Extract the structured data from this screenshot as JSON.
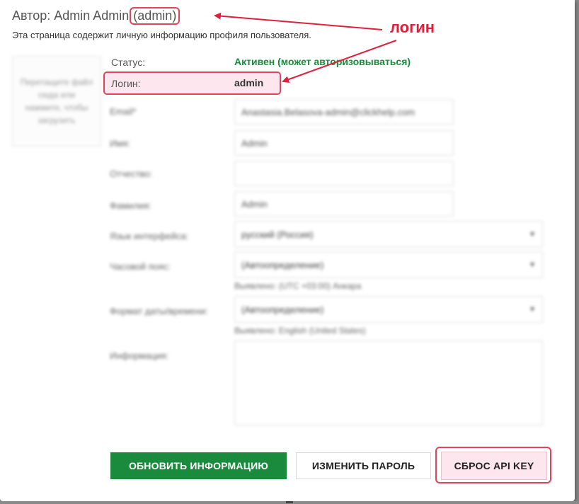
{
  "header": {
    "title_prefix": "Автор: Admin Admin",
    "title_login": "(admin)",
    "subtitle": "Эта страница содержит личную информацию профиля пользователя."
  },
  "annotation": {
    "label": "логин",
    "color": "#e0203a"
  },
  "avatar": {
    "dropzone_text": "Перетащите файл сюда или нажмите, чтобы загрузить"
  },
  "profile": {
    "status_label": "Статус:",
    "status_value": "Активен (может авторизовываться)",
    "login_label": "Логин:",
    "login_value": "admin",
    "fields": {
      "email_label": "Email*",
      "email_value": "Anastasia.Belasova-admin@clickhelp.com",
      "name_label": "Имя:",
      "name_value": "Admin",
      "patronymic_label": "Отчество:",
      "patronymic_value": "",
      "surname_label": "Фамилия:",
      "surname_value": "Admin",
      "language_label": "Язык интерфейса:",
      "language_value": "русский (Россия)",
      "timezone_label": "Часовой пояс:",
      "timezone_value": "(Автоопределение)",
      "timezone_hint": "Выявлено: (UTC +03:00) Анкара",
      "datetime_label": "Формат даты/времени:",
      "datetime_value": "(Автоопределение)",
      "datetime_hint": "Выявлено: English (United States)",
      "info_label": "Информация:"
    }
  },
  "buttons": {
    "update": "ОБНОВИТЬ ИНФОРМАЦИЮ",
    "change_password": "ИЗМЕНИТЬ ПАРОЛЬ",
    "reset_api_key": "СБРОС API KEY"
  },
  "colors": {
    "accent_green": "#1a8a3c",
    "highlight_red": "#e0445a",
    "highlight_pink": "#fde6ee"
  }
}
